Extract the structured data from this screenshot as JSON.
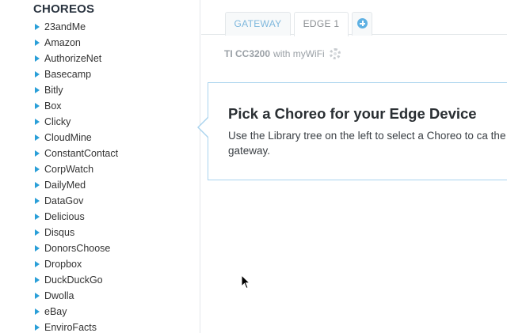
{
  "sidebar": {
    "heading": "CHOREOS",
    "items": [
      {
        "label": "23andMe"
      },
      {
        "label": "Amazon"
      },
      {
        "label": "AuthorizeNet"
      },
      {
        "label": "Basecamp"
      },
      {
        "label": "Bitly"
      },
      {
        "label": "Box"
      },
      {
        "label": "Clicky"
      },
      {
        "label": "CloudMine"
      },
      {
        "label": "ConstantContact"
      },
      {
        "label": "CorpWatch"
      },
      {
        "label": "DailyMed"
      },
      {
        "label": "DataGov"
      },
      {
        "label": "Delicious"
      },
      {
        "label": "Disqus"
      },
      {
        "label": "DonorsChoose"
      },
      {
        "label": "Dropbox"
      },
      {
        "label": "DuckDuckGo"
      },
      {
        "label": "Dwolla"
      },
      {
        "label": "eBay"
      },
      {
        "label": "EnviroFacts"
      }
    ]
  },
  "tabs": {
    "gateway": "GATEWAY",
    "edge": "EDGE 1",
    "add_icon": "plus-circle-icon"
  },
  "device": {
    "name": "TI CC3200",
    "connection": "with myWiFi",
    "settings_icon": "gear-icon"
  },
  "callout": {
    "title": "Pick a Choreo for your Edge Device",
    "text": "Use the Library tree on the left to select a Choreo to ca the gateway."
  },
  "colors": {
    "accent": "#2a9fd8",
    "callout_border": "#a9d3ee",
    "divider": "#e3e7ea"
  }
}
